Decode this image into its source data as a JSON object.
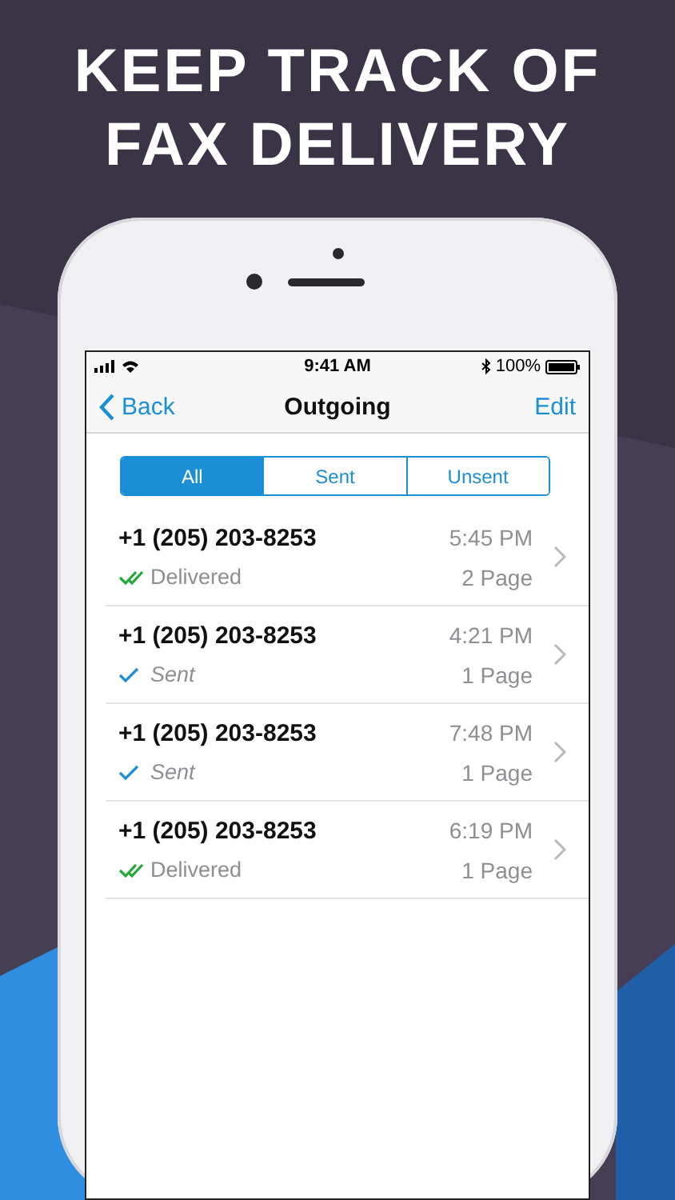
{
  "headline": [
    "KEEP TRACK OF",
    "FAX DELIVERY"
  ],
  "status_bar": {
    "time": "9:41 AM",
    "battery": "100%"
  },
  "nav": {
    "back": "Back",
    "title": "Outgoing",
    "action": "Edit"
  },
  "segments": [
    {
      "label": "All",
      "selected": true
    },
    {
      "label": "Sent",
      "selected": false
    },
    {
      "label": "Unsent",
      "selected": false
    }
  ],
  "faxes": [
    {
      "number": "+1 (205) 203-8253",
      "time": "5:45 PM",
      "status": "Delivered",
      "kind": "delivered",
      "pages": "2 Page"
    },
    {
      "number": "+1 (205) 203-8253",
      "time": "4:21 PM",
      "status": "Sent",
      "kind": "sent",
      "pages": "1 Page"
    },
    {
      "number": "+1 (205) 203-8253",
      "time": "7:48 PM",
      "status": "Sent",
      "kind": "sent",
      "pages": "1 Page"
    },
    {
      "number": "+1 (205) 203-8253",
      "time": "6:19 PM",
      "status": "Delivered",
      "kind": "delivered",
      "pages": "1 Page"
    }
  ]
}
